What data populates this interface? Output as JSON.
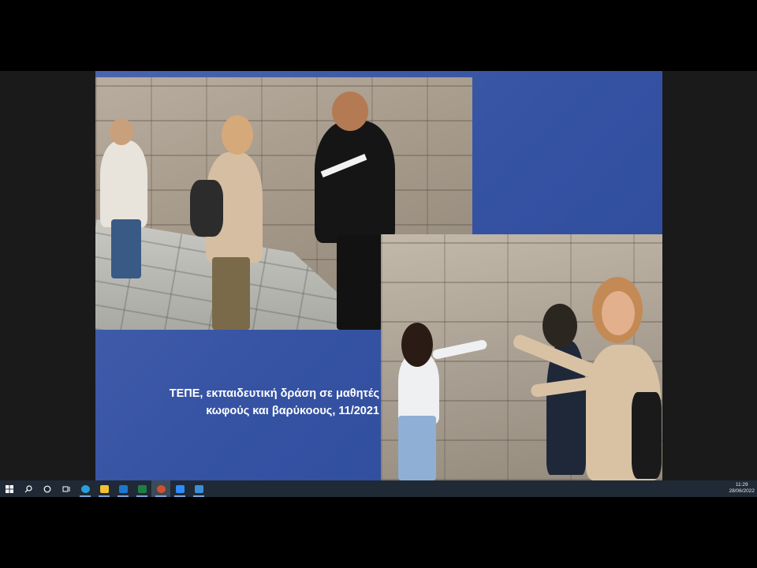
{
  "slide": {
    "caption_line1": "ΤΕΠΕ, εκπαιδευτική δράση σε μαθητές",
    "caption_line2": "κωφούς και βαρύκοους, 11/2021",
    "background_color": "#3552a3"
  },
  "taskbar": {
    "icons": [
      "windows-start-icon",
      "search-icon",
      "cortana-icon",
      "task-view-icon",
      "edge-icon",
      "file-explorer-icon",
      "mail-icon",
      "excel-icon",
      "powerpoint-icon",
      "zoom-icon",
      "photos-icon"
    ],
    "time": "11:29",
    "date": "28/06/2022"
  }
}
